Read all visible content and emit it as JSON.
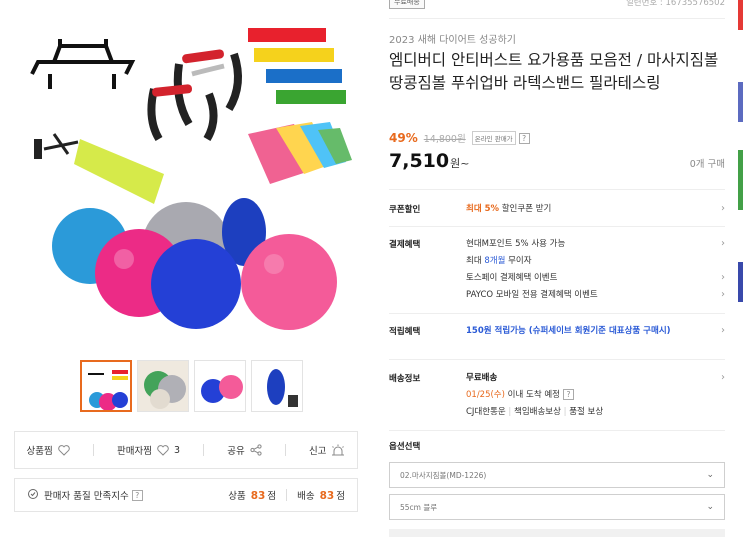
{
  "header": {
    "badge": "무료배송",
    "product_no": "일련번호 : 16735576502"
  },
  "product": {
    "subtitle": "2023 새해 다이어트 성공하기",
    "title": "엠디버디 안티버스트 요가용품 모음전 / 마사지짐볼 땅콩짐볼 푸쉬업바 라텍스밴드 필라테스링",
    "discount": "49%",
    "original_price": "14,800원",
    "min_price_badge": "온라인 판매가",
    "price": "7,510",
    "price_unit": "원~",
    "purchase_count": "0개 구매"
  },
  "coupon": {
    "label": "쿠폰할인",
    "highlight": "최대 5%",
    "text": " 할인쿠폰 받기"
  },
  "payment": {
    "label": "결제혜택",
    "lines": [
      "현대M포인트 5% 사용 가능",
      "최대 8개월 무이자",
      "토스페이 결제혜택 이벤트",
      "PAYCO 모바일 전용 결제혜택 이벤트"
    ],
    "line2_prefix": "최대 ",
    "line2_highlight": "8개월",
    "line2_suffix": " 무이자"
  },
  "points": {
    "label": "적립혜택",
    "text": "150원 적립가능 (슈퍼세이브 회원기준 대표상품 구매시)"
  },
  "delivery": {
    "label": "배송정보",
    "type": "무료배송",
    "date": "01/25(수)",
    "date_suffix": " 이내 도착 예정",
    "carrier": "CJ대한통운",
    "badge1": "책임배송보상",
    "badge2": "품절 보상"
  },
  "options": {
    "label": "옵션선택",
    "select1": "02.마사지짐볼(MD-1226)",
    "select2": "55cm 블루"
  },
  "actions": {
    "product_like": "상품찜",
    "seller_like": "판매자찜",
    "seller_like_count": "3",
    "share": "공유",
    "report": "신고"
  },
  "satisfaction": {
    "label": "판매자 품질 만족지수",
    "product_label": "상품",
    "product_score": "83",
    "delivery_label": "배송",
    "delivery_score": "83",
    "unit": "점"
  },
  "colors": {
    "accent": "#e86a1e",
    "link": "#2a5ad6"
  }
}
